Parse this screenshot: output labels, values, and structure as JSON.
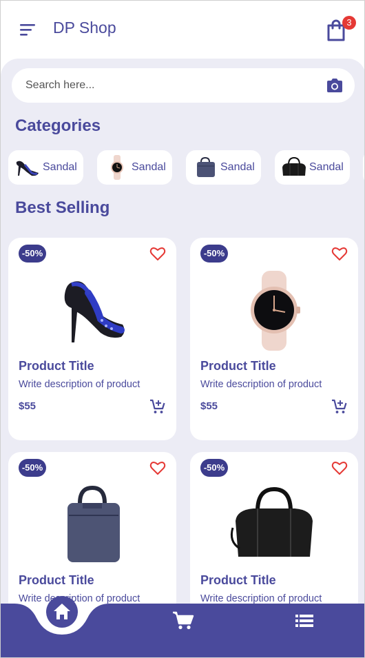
{
  "header": {
    "title": "DP Shop",
    "cart_count": "3",
    "menu_icon": "menu-icon",
    "cart_icon": "shopping-bag-icon"
  },
  "search": {
    "placeholder": "Search here...",
    "value": "",
    "icon": "camera-icon"
  },
  "categories": {
    "title": "Categories",
    "items": [
      {
        "label": "Sandal",
        "icon": "sandal-thumb"
      },
      {
        "label": "Sandal",
        "icon": "watch-thumb"
      },
      {
        "label": "Sandal",
        "icon": "laptop-bag-thumb"
      },
      {
        "label": "Sandal",
        "icon": "duffel-bag-thumb"
      }
    ]
  },
  "best_selling": {
    "title": "Best Selling",
    "products": [
      {
        "discount": "-50%",
        "title": "Product Title",
        "description": "Write description of product",
        "price": "$55",
        "image": "sandal-image"
      },
      {
        "discount": "-50%",
        "title": "Product Title",
        "description": "Write description of product",
        "price": "$55",
        "image": "watch-image"
      },
      {
        "discount": "-50%",
        "title": "Product Title",
        "description": "Write description of product",
        "price": "",
        "image": "laptop-bag-image"
      },
      {
        "discount": "-50%",
        "title": "Product Title",
        "description": "Write description of product",
        "price": "",
        "image": "duffel-bag-image"
      }
    ]
  },
  "bottom_nav": {
    "items": [
      "home-icon",
      "cart-icon",
      "list-icon"
    ]
  },
  "colors": {
    "primary": "#4a4a9c",
    "badge": "#e53935",
    "background": "#ececf5",
    "heart": "#e53935"
  }
}
